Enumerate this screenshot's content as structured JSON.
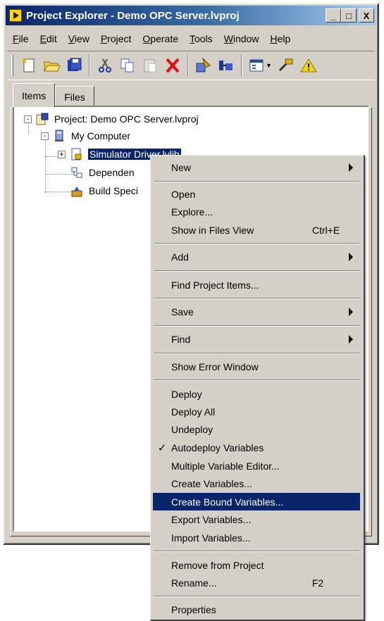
{
  "window": {
    "title": "Project Explorer - Demo OPC Server.lvproj",
    "minimize": "_",
    "maximize": "□",
    "close": "X"
  },
  "menubar": [
    {
      "label": "File",
      "u": "F",
      "rest": "ile"
    },
    {
      "label": "Edit",
      "u": "E",
      "rest": "dit"
    },
    {
      "label": "View",
      "u": "V",
      "rest": "iew"
    },
    {
      "label": "Project",
      "u": "P",
      "rest": "roject"
    },
    {
      "label": "Operate",
      "u": "O",
      "rest": "perate"
    },
    {
      "label": "Tools",
      "u": "T",
      "rest": "ools"
    },
    {
      "label": "Window",
      "u": "W",
      "rest": "indow"
    },
    {
      "label": "Help",
      "u": "H",
      "rest": "elp"
    }
  ],
  "toolbar_icons": [
    "new-icon",
    "open-folder-icon",
    "save-all-icon",
    "cut-icon",
    "copy-icon",
    "paste-icon",
    "delete-icon",
    "project-add-icon",
    "build-icon",
    "view-dropdown-icon",
    "tools-icon",
    "warning-icon"
  ],
  "tabs": [
    {
      "label": "Items",
      "active": true
    },
    {
      "label": "Files",
      "active": false
    }
  ],
  "tree": {
    "project": "Project: Demo OPC Server.lvproj",
    "computer": "My Computer",
    "library": "Simulator Driver.lvlib",
    "dependencies": "Dependen",
    "build": "Build Speci",
    "expander_collapsed": "+",
    "expander_expanded": "-"
  },
  "context_menu": {
    "new": "New",
    "open": "Open",
    "explore": "Explore...",
    "show_in_files": "Show in Files View",
    "show_in_files_shortcut": "Ctrl+E",
    "add": "Add",
    "find_project_items": "Find Project Items...",
    "save": "Save",
    "find": "Find",
    "show_error_window": "Show Error Window",
    "deploy": "Deploy",
    "deploy_all": "Deploy All",
    "undeploy": "Undeploy",
    "autodeploy_check": "✓",
    "autodeploy": "Autodeploy Variables",
    "multi_var_editor": "Multiple Variable Editor...",
    "create_variables": "Create Variables...",
    "create_bound_variables": "Create Bound Variables...",
    "export_variables": "Export Variables...",
    "import_variables": "Import Variables...",
    "remove_from_project": "Remove from Project",
    "rename": "Rename...",
    "rename_shortcut": "F2",
    "properties": "Properties"
  },
  "colors": {
    "selection": "#0a246a",
    "face": "#d4d0c8"
  }
}
